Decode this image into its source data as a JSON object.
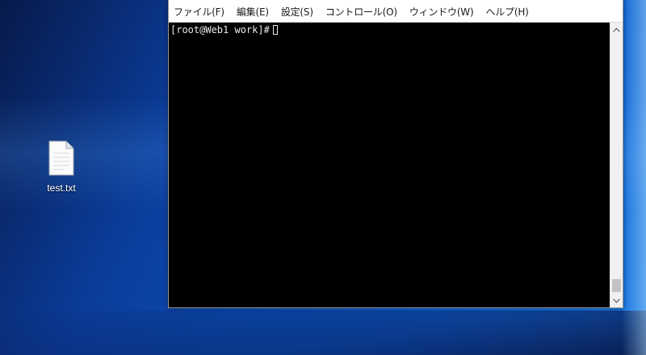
{
  "colors": {
    "terminal_bg": "#000000",
    "terminal_fg": "#e8e8e8",
    "menubar_bg": "#ffffff"
  },
  "desktop": {
    "icons": [
      {
        "label": "test.txt",
        "icon": "text-file-icon"
      }
    ]
  },
  "terminal": {
    "menu": [
      {
        "label": "ファイル(F)"
      },
      {
        "label": "編集(E)"
      },
      {
        "label": "設定(S)"
      },
      {
        "label": "コントロール(O)"
      },
      {
        "label": "ウィンドウ(W)"
      },
      {
        "label": "ヘルプ(H)"
      }
    ],
    "prompt": "[root@Web1 work]#",
    "scrollbar": {
      "up_icon": "chevron-up-icon",
      "down_icon": "chevron-down-icon",
      "position": 1.0
    }
  }
}
